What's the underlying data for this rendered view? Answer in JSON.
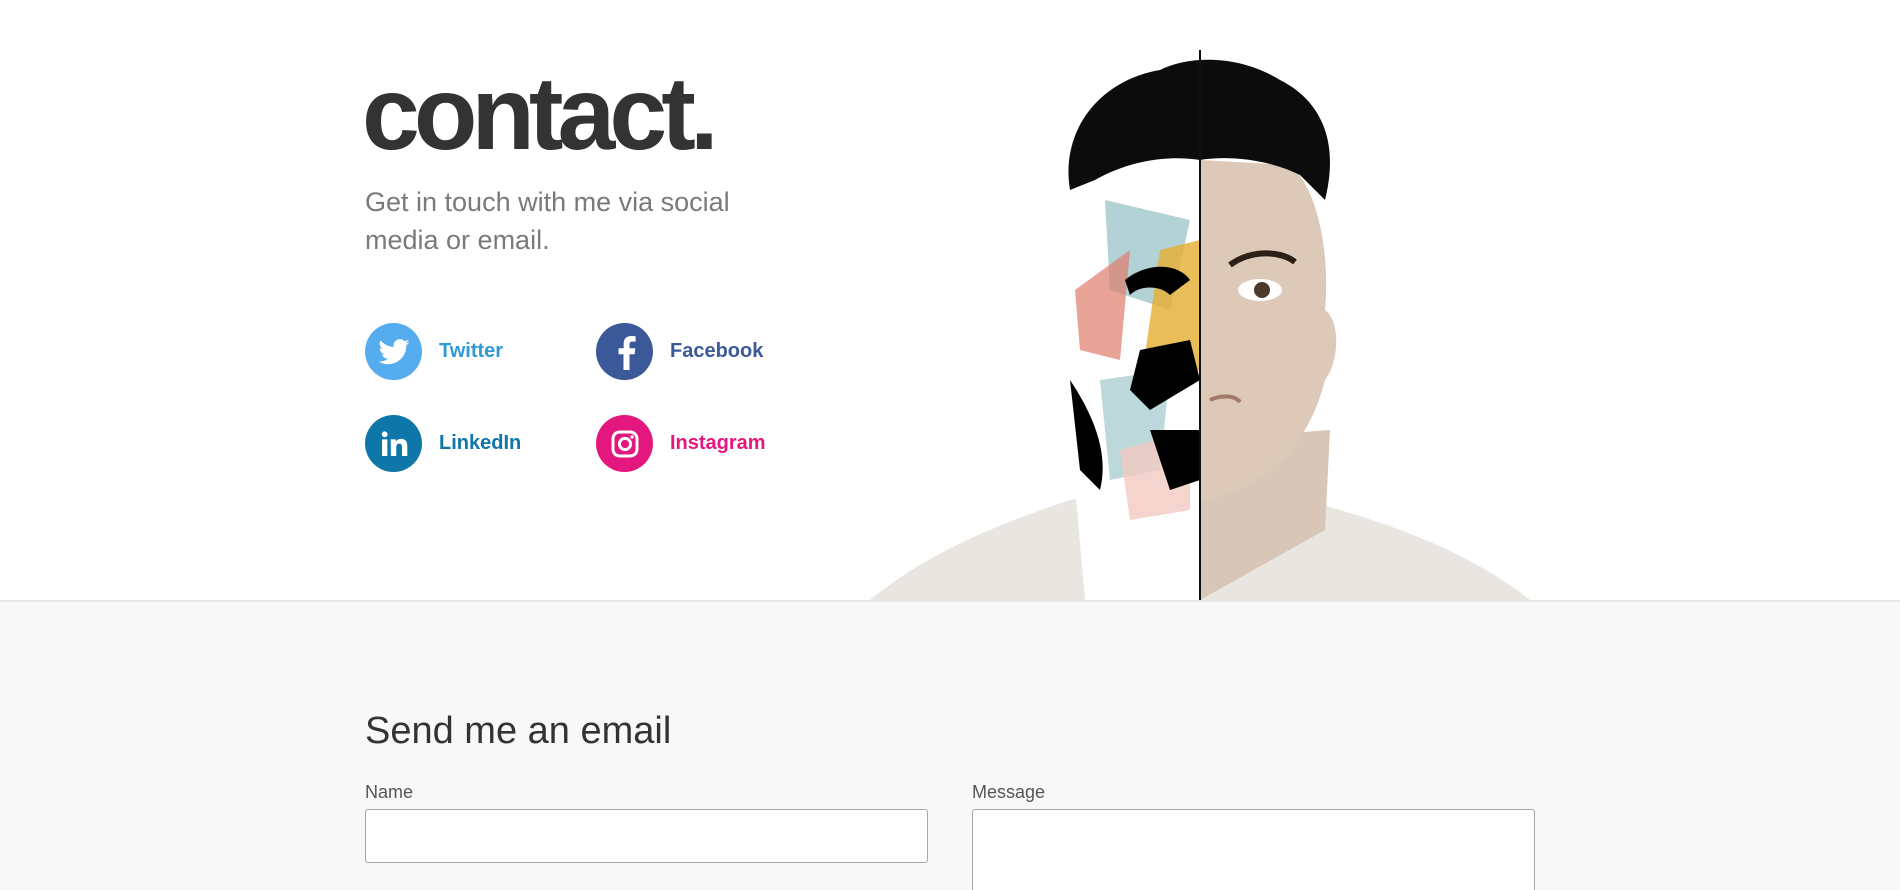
{
  "hero": {
    "title": "contact.",
    "subtitle": "Get in touch with me via social media or email."
  },
  "social": {
    "twitter": {
      "label": "Twitter",
      "icon": "twitter-icon",
      "color": "#55acee"
    },
    "facebook": {
      "label": "Facebook",
      "icon": "facebook-icon",
      "color": "#3b5998"
    },
    "linkedin": {
      "label": "LinkedIn",
      "icon": "linkedin-icon",
      "color": "#0e76a8"
    },
    "instagram": {
      "label": "Instagram",
      "icon": "instagram-icon",
      "color": "#e4177f"
    }
  },
  "portrait": {
    "icon": "portrait-illustration"
  },
  "form": {
    "title": "Send me an email",
    "name_label": "Name",
    "name_value": "",
    "message_label": "Message",
    "message_value": ""
  }
}
